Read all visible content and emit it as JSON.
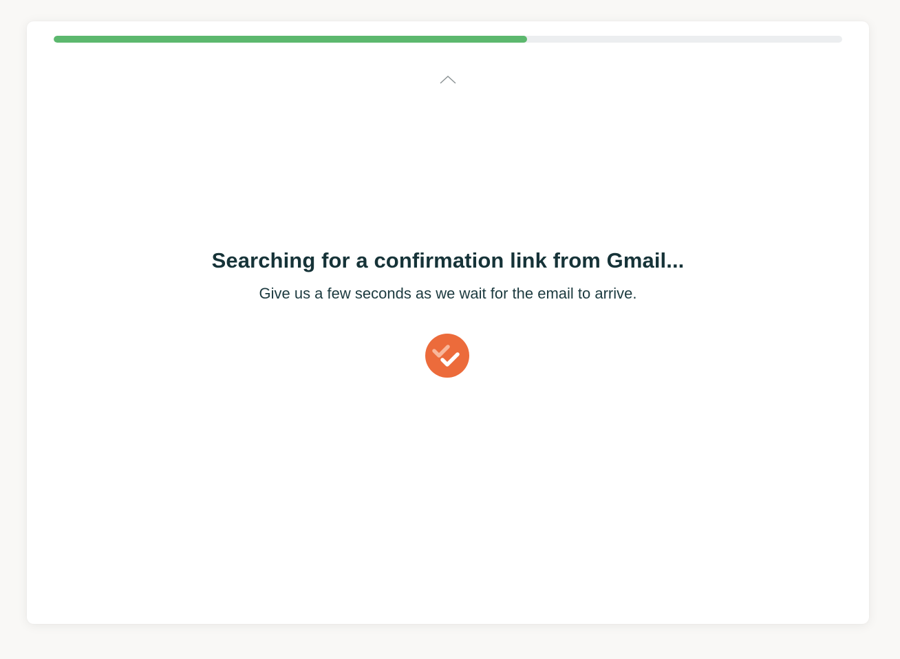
{
  "progress": {
    "fraction": 0.6,
    "fill_color": "#5cb86e",
    "track_color": "#eceef0"
  },
  "collapse_toggle": {
    "icon": "chevron-up-icon"
  },
  "status": {
    "title": "Searching for a confirmation link from Gmail...",
    "subtitle": "Give us a few seconds as we wait for the email to arrive."
  },
  "logo": {
    "icon": "double-check-logo-icon",
    "color": "#ec6b3b"
  }
}
